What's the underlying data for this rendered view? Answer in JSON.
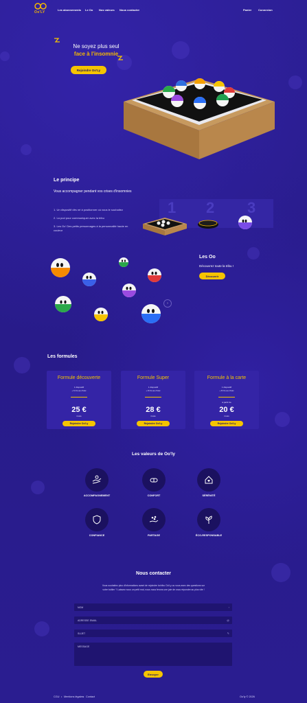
{
  "brand": {
    "name": "Oo'LY"
  },
  "nav": {
    "items": [
      "Les abonnements",
      "Le Oo",
      "Nos valeurs",
      "Nous contacter"
    ],
    "right": [
      "Panier",
      "Connexion"
    ]
  },
  "hero": {
    "line1": "Ne soyez plus seul",
    "line2": "face à l'insomnie",
    "cta": "Rejoindre Oo'Ly"
  },
  "principe": {
    "title": "Le principe",
    "subtitle": "Vous accompagner pendant vos crises d'insomnies",
    "points": [
      "1. Un dispositif dès né à positionner où vous le souhaitez",
      "2. La pod pour communiquer avec la tribu",
      "3. Les Oo' Des petits personnages à la personnalité haute en couleur"
    ],
    "steps": [
      "1",
      "2",
      "3"
    ]
  },
  "oo": {
    "title": "Les Oo",
    "text": "Découvrez toute la tribu !",
    "cta": "Découvrir"
  },
  "formules": {
    "title": "Les formules",
    "cards": [
      {
        "name": "Formule découverte",
        "f1": "1 dispositif",
        "f2": "+ 6 Oo au choix",
        "pre": "",
        "price": "25 €",
        "per": "/mois",
        "cta": "Rejoindre Oo'Ly"
      },
      {
        "name": "Formule Super",
        "f1": "1 dispositif",
        "f2": "+ 8 Oo au choix",
        "pre": "",
        "price": "28 €",
        "per": "/mois",
        "cta": "Rejoindre Oo'Ly"
      },
      {
        "name": "Formule à la carte",
        "f1": "1 dispositif",
        "f2": "+ 8 Oo au choix",
        "pre": "à partir de",
        "price": "20 €",
        "per": "/mois",
        "cta": "Rejoindre Oo'Ly"
      }
    ]
  },
  "valeurs": {
    "title": "Les valeurs de Oo'ly",
    "items": [
      {
        "label": "ACCOMPAGNEMENT",
        "icon": "hands-icon"
      },
      {
        "label": "CONFORT",
        "icon": "pill-icon"
      },
      {
        "label": "SÉRÉNITÉ",
        "icon": "home-heart-icon"
      },
      {
        "label": "CONFIANCE",
        "icon": "shield-icon"
      },
      {
        "label": "PARTAGE",
        "icon": "share-hand-icon"
      },
      {
        "label": "ÉCO-RESPONSABLE",
        "icon": "leaf-icon"
      }
    ]
  },
  "contact": {
    "title": "Nous contacter",
    "intro1": "Vous souhaitez plus d'informations avant de rejoindre la tribu Oo'Ly ou vous avez des questions sur",
    "intro2": "votre boîtier ? Laissez nous un petit mot, nous nous ferons une joie de vous répondre au plus vite !",
    "fields": {
      "name": "NOM",
      "email": "ADRESSE EMAIL",
      "subject": "SUJET",
      "message": "MESSAGE"
    },
    "submit": "Envoyer"
  },
  "footer": {
    "links": [
      "CGU",
      "Mentions légales",
      "Contact"
    ],
    "copyright": "Oo'ly © 2026"
  },
  "colors": {
    "bg": "#2a1d8f",
    "accent": "#f5c400",
    "card": "#3424a6"
  }
}
